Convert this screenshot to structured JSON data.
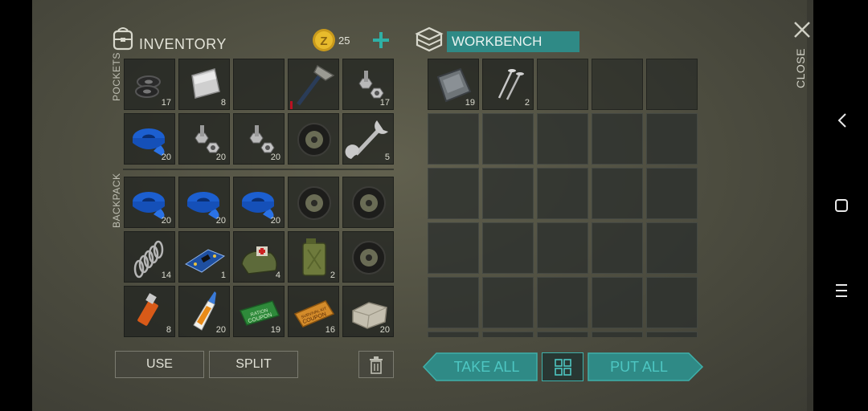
{
  "inventory": {
    "title": "INVENTORY",
    "coins": "25",
    "add_icon": "plus-icon",
    "pockets_label": "POCKETS",
    "backpack_label": "BACKPACK",
    "pockets": [
      {
        "item": "washers",
        "count": "17"
      },
      {
        "item": "metal-plate",
        "count": "8"
      },
      {
        "item": "empty",
        "count": ""
      },
      {
        "item": "hatchet",
        "count": ""
      },
      {
        "item": "bolts",
        "count": "17"
      },
      {
        "item": "blue-tape",
        "count": "20"
      },
      {
        "item": "bolts",
        "count": "20"
      },
      {
        "item": "bolts",
        "count": "20"
      },
      {
        "item": "tire",
        "count": ""
      },
      {
        "item": "wrench",
        "count": "5"
      }
    ],
    "backpack": [
      {
        "item": "blue-tape",
        "count": "20"
      },
      {
        "item": "blue-tape",
        "count": "20"
      },
      {
        "item": "blue-tape",
        "count": "20"
      },
      {
        "item": "tire",
        "count": ""
      },
      {
        "item": "tire",
        "count": ""
      },
      {
        "item": "spring",
        "count": "14"
      },
      {
        "item": "circuit-board",
        "count": "1"
      },
      {
        "item": "medical-bag",
        "count": "4"
      },
      {
        "item": "jerrycan",
        "count": "2"
      },
      {
        "item": "tire",
        "count": ""
      },
      {
        "item": "usb-stick",
        "count": "8"
      },
      {
        "item": "glue",
        "count": "20"
      },
      {
        "item": "green-coupon",
        "count": "19"
      },
      {
        "item": "orange-coupon",
        "count": "16"
      },
      {
        "item": "stone-brick",
        "count": "20"
      }
    ],
    "use_label": "USE",
    "split_label": "SPLIT",
    "trash_icon": "trash-icon"
  },
  "workbench": {
    "title": "WORKBENCH",
    "items": [
      {
        "item": "metal-sheet",
        "count": "19"
      },
      {
        "item": "nails",
        "count": "2"
      }
    ],
    "take_all_label": "TAKE ALL",
    "put_all_label": "PUT ALL",
    "sort_icon": "grid-icon"
  },
  "close_label": "CLOSE",
  "colors": {
    "accent_teal": "#2f8a86",
    "teal_text": "#4dc6c2",
    "panel_bg": "#525243"
  },
  "item_labels": {
    "green_coupon": [
      "RATION",
      "COUPON"
    ],
    "orange_coupon": [
      "SURVIVAL KIT",
      "COUPON"
    ]
  }
}
